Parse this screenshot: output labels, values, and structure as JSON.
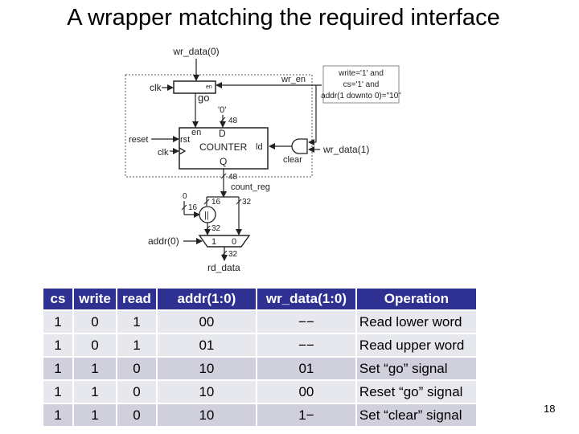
{
  "slide": {
    "title": "A wrapper matching the required interface",
    "page_number": "18"
  },
  "diagram": {
    "signals": {
      "wr_data0": "wr_data(0)",
      "clk_go": "clk",
      "en_go": "en",
      "go": "go",
      "zero_lit": "'0'",
      "w48_d": "48",
      "en_counter": "en",
      "d": "D",
      "reset": "reset",
      "rst": "rst",
      "clk_counter": "clk",
      "counter": "COUNTER",
      "ld": "ld",
      "q": "Q",
      "w48_q": "48",
      "count_reg": "count_reg",
      "wr_en": "wr_en",
      "clear": "clear",
      "wr_data1": "wr_data(1)",
      "zero_const": "0",
      "w16_a": "16",
      "w16_b": "16",
      "w32_a": "32",
      "concat": "||",
      "w32_b": "32",
      "mux_in1": "1",
      "mux_in0": "0",
      "addr0": "addr(0)",
      "w32_out": "32",
      "rd_data": "rd_data"
    },
    "condition_box": [
      "write='1' and",
      "cs='1' and",
      "addr(1 downto 0)=\"10\""
    ]
  },
  "table": {
    "headers": [
      "cs",
      "write",
      "read",
      "addr(1:0)",
      "wr_data(1:0)",
      "Operation"
    ],
    "rows": [
      [
        "1",
        "0",
        "1",
        "00",
        "−−",
        "Read lower word"
      ],
      [
        "1",
        "0",
        "1",
        "01",
        "−−",
        "Read upper word"
      ],
      [
        "1",
        "1",
        "0",
        "10",
        "01",
        "Set “go” signal"
      ],
      [
        "1",
        "1",
        "0",
        "10",
        "00",
        "Reset “go” signal"
      ],
      [
        "1",
        "1",
        "0",
        "10",
        "1−",
        "Set “clear” signal"
      ]
    ]
  },
  "colors": {
    "header_bg": "#2e3192",
    "row_light": "#e7e8ee",
    "row_dark": "#cfd0dc"
  }
}
